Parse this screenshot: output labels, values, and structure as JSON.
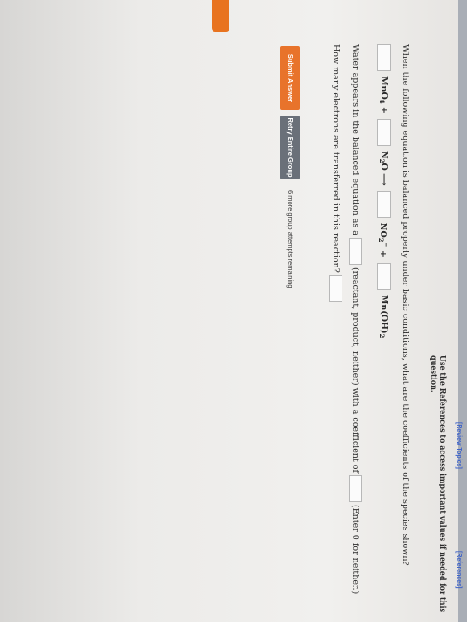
{
  "nav": {
    "review_topics": "[Review Topics]",
    "references": "[References]"
  },
  "instructions": "Use the References to access important values if needed for this question.",
  "question1": "When the following equation is balanced properly under basic conditions, what are the coefficients of the species shown?",
  "equation": {
    "species": [
      {
        "main": "MnO",
        "sub": "4",
        "sup": "",
        "suffix": "+"
      },
      {
        "main": "N",
        "sub": "2",
        "sup": "",
        "suffix": "O ⟶"
      },
      {
        "main": "NO",
        "sub": "2",
        "sup": "−",
        "suffix": "+"
      },
      {
        "main": "Mn(OH)",
        "sub": "2",
        "sup": "",
        "suffix": ""
      }
    ]
  },
  "question2": {
    "prefix": "Water appears in the balanced equation as a",
    "middle": "(reactant, product, neither) with a coefficient of",
    "suffix": "(Enter 0 for neither.)"
  },
  "question3": "How many electrons are transferred in this reaction?",
  "buttons": {
    "submit": "Submit Answer",
    "retry": "Retry Entire Group"
  },
  "attempts": "6 more group attempts remaining",
  "colors": {
    "accent": "#e8732b",
    "retry": "#6a7079",
    "link": "#3e63c9"
  }
}
